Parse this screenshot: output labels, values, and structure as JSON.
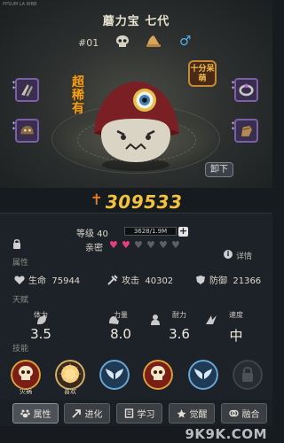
{
  "topbar": {
    "small_text": "PPSUM LA WBB"
  },
  "pet": {
    "name": "蘑力宝 七代",
    "number": "#01",
    "rarity_label": "超稀有",
    "tag_label": "十分呆萌",
    "unequip_label": "卸下",
    "power": "309533",
    "gender_icon": "male-icon",
    "colors": {
      "rarity": "#f0a21e",
      "power": "#f2c23d",
      "gender": "#4fb0e6",
      "accent_purple": "#7b5fa8"
    }
  },
  "level": {
    "label": "等级 40",
    "exp_text": "3628/1.9M"
  },
  "intimacy": {
    "label": "亲密",
    "filled": 2,
    "total": 6
  },
  "detail_label": "详情",
  "attributes": {
    "section_label": "属性",
    "items": [
      {
        "label": "生命",
        "value": "75944",
        "icon": "health-icon"
      },
      {
        "label": "攻击",
        "value": "40302",
        "icon": "attack-icon"
      },
      {
        "label": "防御",
        "value": "21366",
        "icon": "defense-icon"
      }
    ]
  },
  "talents": {
    "section_label": "天赋",
    "items": [
      {
        "label": "体力",
        "value": "3.5",
        "icon": "stamina-icon"
      },
      {
        "label": "力量",
        "value": "8.0",
        "icon": "strength-icon"
      },
      {
        "label": "耐力",
        "value": "3.6",
        "icon": "endurance-icon"
      },
      {
        "label": "速度",
        "value": "中",
        "icon": "speed-icon"
      }
    ]
  },
  "skills": {
    "section_label": "技能",
    "items": [
      {
        "label": "灾祸",
        "icon": "skull-skill-icon"
      },
      {
        "label": "喜欢",
        "icon": "burst-skill-icon"
      },
      {
        "label": "",
        "icon": "wing-skill-icon"
      },
      {
        "label": "",
        "icon": "skull-skill-icon"
      },
      {
        "label": "",
        "icon": "wing-skill-icon"
      },
      {
        "label": "",
        "icon": "locked-skill-icon"
      }
    ]
  },
  "tabs": [
    {
      "label": "属性",
      "icon": "paw-icon",
      "active": true
    },
    {
      "label": "进化",
      "icon": "evolve-arrow-icon",
      "active": false
    },
    {
      "label": "学习",
      "icon": "book-icon",
      "active": false
    },
    {
      "label": "觉醒",
      "icon": "awaken-icon",
      "active": false
    },
    {
      "label": "融合",
      "icon": "fusion-icon",
      "active": false
    }
  ],
  "watermark": "9K9K.COM"
}
